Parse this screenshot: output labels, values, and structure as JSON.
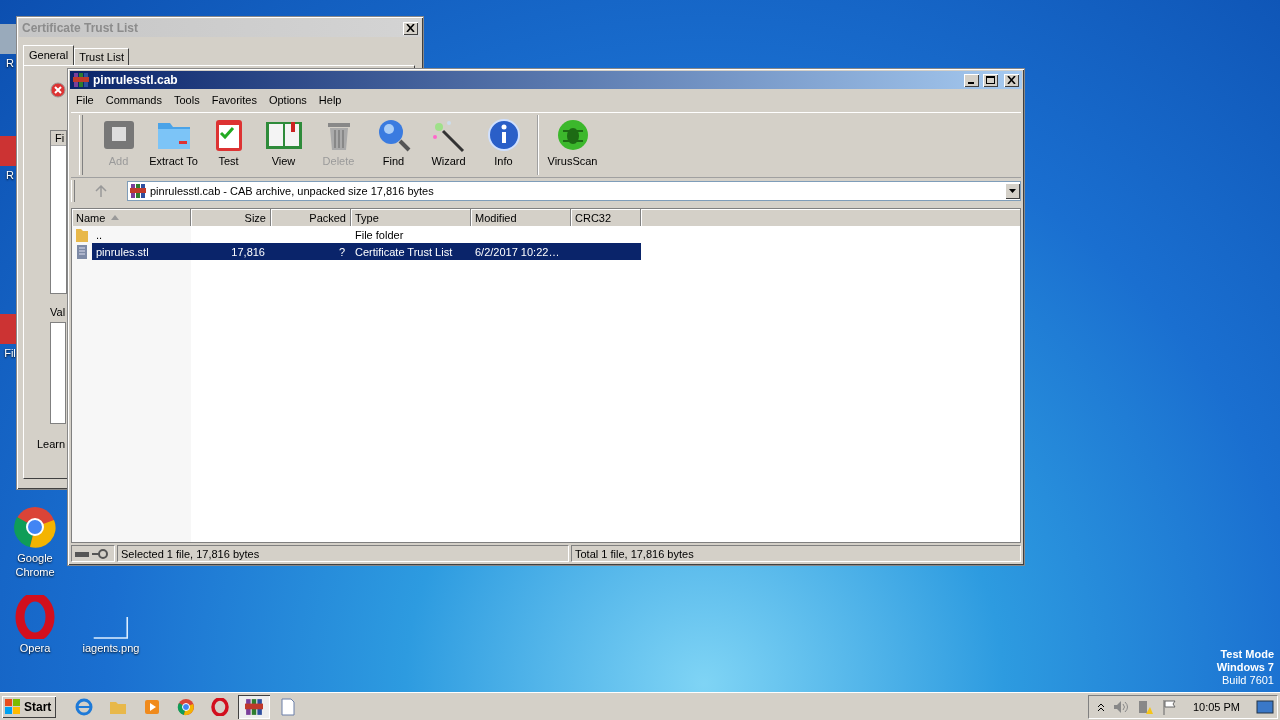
{
  "desktop": {
    "icons": [
      {
        "kind": "bin",
        "label": "R"
      },
      {
        "kind": "app",
        "label": "R"
      },
      {
        "kind": "app",
        "label": "Fil"
      },
      {
        "kind": "chrome",
        "label": "Google Chrome"
      },
      {
        "kind": "opera",
        "label": "Opera"
      },
      {
        "kind": "file",
        "label": "iagents.png"
      }
    ],
    "os_info": [
      "Test Mode",
      "Windows 7",
      "Build 7601"
    ]
  },
  "dialog": {
    "title": "Certificate Trust List",
    "tabs": [
      {
        "label": "General",
        "selected": true
      },
      {
        "label": "Trust List",
        "selected": false
      }
    ],
    "list_header": "Fi",
    "value_label": "Val",
    "link": "Learn"
  },
  "window": {
    "title": "pinrulesstl.cab",
    "menu": [
      "File",
      "Commands",
      "Tools",
      "Favorites",
      "Options",
      "Help"
    ],
    "toolbar": [
      {
        "kind": "add",
        "label": "Add",
        "disabled": true
      },
      {
        "kind": "extract",
        "label": "Extract To",
        "disabled": false
      },
      {
        "kind": "test",
        "label": "Test",
        "disabled": false
      },
      {
        "kind": "view",
        "label": "View",
        "disabled": false
      },
      {
        "kind": "delete",
        "label": "Delete",
        "disabled": true
      },
      {
        "kind": "find",
        "label": "Find",
        "disabled": false
      },
      {
        "kind": "wizard",
        "label": "Wizard",
        "disabled": false
      },
      {
        "kind": "info",
        "label": "Info",
        "disabled": false
      },
      {
        "kind": "virus",
        "label": "VirusScan",
        "disabled": false
      }
    ],
    "address": "pinrulesstl.cab - CAB archive, unpacked size 17,816 bytes",
    "columns": [
      {
        "label": "Name",
        "sorted": true
      },
      {
        "label": "Size",
        "sorted": false
      },
      {
        "label": "Packed",
        "sorted": false
      },
      {
        "label": "Type",
        "sorted": false
      },
      {
        "label": "Modified",
        "sorted": false
      },
      {
        "label": "CRC32",
        "sorted": false
      }
    ],
    "rows": [
      {
        "kind": "folder",
        "selected": false,
        "cells": [
          "..",
          null,
          null,
          "File folder",
          null,
          null
        ]
      },
      {
        "kind": "file",
        "selected": true,
        "cells": [
          "pinrules.stl",
          "17,816",
          "?",
          "Certificate Trust List",
          "6/2/2017 10:22…",
          null
        ]
      }
    ],
    "status": [
      "Selected 1 file, 17,816 bytes",
      "Total 1 file, 17,816 bytes"
    ]
  },
  "taskbar": {
    "start": "Start",
    "apps": [
      {
        "kind": "ie",
        "selected": false
      },
      {
        "kind": "explorer",
        "selected": false
      },
      {
        "kind": "media",
        "selected": false
      },
      {
        "kind": "chrome",
        "selected": false
      },
      {
        "kind": "opera",
        "selected": false
      },
      {
        "kind": "winrar",
        "selected": true
      },
      {
        "kind": "notepad",
        "selected": false
      }
    ],
    "clock": "10:05 PM"
  }
}
